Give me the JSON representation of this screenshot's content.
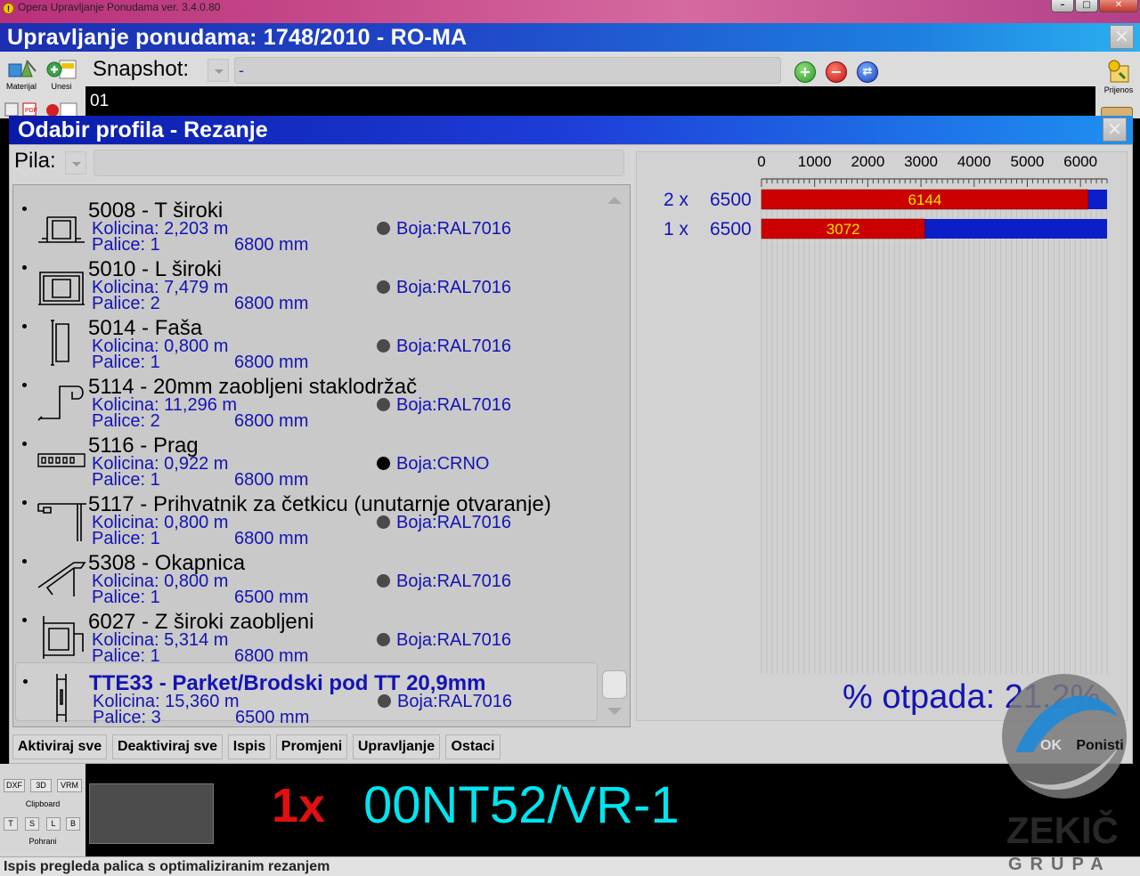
{
  "os_window": {
    "title": "Opera Upravljanje Ponudama ver. 3.4.0.80"
  },
  "main_window": {
    "title": "Upravljanje ponudama: 1748/2010 - RO-MA"
  },
  "toolbar": {
    "materijal_label": "Materijal",
    "unesi_label": "Unesi",
    "prijenos_label": "Prijenos",
    "snapshot_label": "Snapshot:",
    "snapshot_value": "-",
    "position_value": "01"
  },
  "dialog": {
    "title": "Odabir profila - Rezanje",
    "pila_label": "Pila:",
    "items": [
      {
        "name": "5008 - T široki",
        "qty": "Kolicina: 2,203 m",
        "bars": "Palice: 1",
        "length": "6800 mm",
        "color": "Boja:RAL7016",
        "icon": "t-wide-profile-icon"
      },
      {
        "name": "5010 - L široki",
        "qty": "Kolicina: 7,479 m",
        "bars": "Palice: 2",
        "length": "6800 mm",
        "color": "Boja:RAL7016",
        "icon": "l-wide-profile-icon"
      },
      {
        "name": "5014 - Faša",
        "qty": "Kolicina: 0,800 m",
        "bars": "Palice: 1",
        "length": "6800 mm",
        "color": "Boja:RAL7016",
        "icon": "fasa-profile-icon"
      },
      {
        "name": "5114 - 20mm zaobljeni staklodržač",
        "qty": "Kolicina: 11,296 m",
        "bars": "Palice: 2",
        "length": "6800 mm",
        "color": "Boja:RAL7016",
        "icon": "glazing-bead-icon"
      },
      {
        "name": "5116 - Prag",
        "qty": "Kolicina: 0,922 m",
        "bars": "Palice: 1",
        "length": "6800 mm",
        "color": "Boja:CRNO",
        "icon": "threshold-profile-icon"
      },
      {
        "name": "5117 - Prihvatnik za četkicu (unutarnje otvaranje)",
        "qty": "Kolicina: 0,800 m",
        "bars": "Palice: 1",
        "length": "6800 mm",
        "color": "Boja:RAL7016",
        "icon": "brush-holder-icon"
      },
      {
        "name": "5308 - Okapnica",
        "qty": "Kolicina: 0,800 m",
        "bars": "Palice: 1",
        "length": "6500 mm",
        "color": "Boja:RAL7016",
        "icon": "drip-profile-icon"
      },
      {
        "name": "6027 - Z široki zaobljeni",
        "qty": "Kolicina: 5,314 m",
        "bars": "Palice: 1",
        "length": "6800 mm",
        "color": "Boja:RAL7016",
        "icon": "z-wide-profile-icon"
      },
      {
        "name": "TTE33 - Parket/Brodski pod TT 20,9mm",
        "qty": "Kolicina: 15,360 m",
        "bars": "Palice: 3",
        "length": "6500 mm",
        "color": "Boja:RAL7016",
        "icon": "parquet-profile-icon"
      }
    ],
    "buttons": {
      "activate_all": "Aktiviraj sve",
      "deactivate_all": "Deaktiviraj sve",
      "print": "Ispis",
      "change": "Promjeni",
      "manage": "Upravljanje",
      "remainders": "Ostaci",
      "ok": "OK",
      "cancel": "Ponisti"
    },
    "waste": "% otpada: 21.2%"
  },
  "chart_data": {
    "type": "bar",
    "orientation": "horizontal",
    "xlim": [
      0,
      6500
    ],
    "xticks": [
      0,
      1000,
      2000,
      3000,
      4000,
      5000,
      6000
    ],
    "rows": [
      {
        "count_label": "2 x",
        "stock_label": "6500",
        "stock": 6500,
        "used": 6144,
        "used_label": "6144"
      },
      {
        "count_label": "1 x",
        "stock_label": "6500",
        "stock": 6500,
        "used": 3072,
        "used_label": "3072"
      }
    ],
    "colors": {
      "used": "#cc0000",
      "remaining": "#0c1ec8",
      "label": "#f5e400"
    }
  },
  "side_tools": {
    "dxf": "DXF",
    "3d": "3D",
    "vrm": "VRM",
    "clipboard": "Clipboard",
    "t": "T",
    "s": "S",
    "l": "L",
    "b": "B",
    "save": "Pohrani"
  },
  "position_display": {
    "count": "1x",
    "code": "00NT52/VR-1"
  },
  "status_bar": {
    "text": "Ispis pregleda palica s optimaliziranim rezanjem"
  },
  "logo": {
    "line1": "ZEKIČ",
    "line2": "GRUPA"
  }
}
